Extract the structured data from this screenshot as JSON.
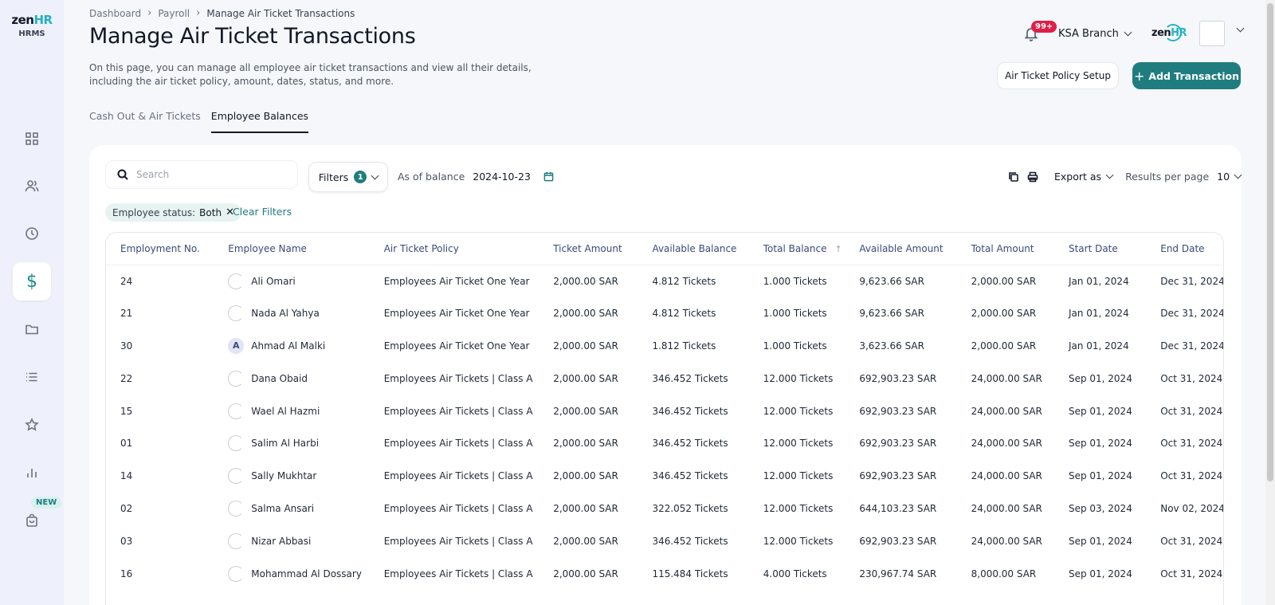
{
  "app": {
    "logo_main": "zen",
    "logo_accent": "HR",
    "logo_sub": "HRMS"
  },
  "sidebar": {
    "new_badge": "NEW",
    "items": [
      {
        "icon": "grid-icon"
      },
      {
        "icon": "users-icon"
      },
      {
        "icon": "clock-icon"
      },
      {
        "icon": "dollar-icon",
        "glyph": "$",
        "active": true
      },
      {
        "icon": "folder-icon"
      },
      {
        "icon": "list-icon"
      },
      {
        "icon": "star-icon"
      },
      {
        "icon": "bar-chart-icon"
      },
      {
        "icon": "bag-icon"
      }
    ]
  },
  "breadcrumb": {
    "items": [
      "Dashboard",
      "Payroll",
      "Manage Air Ticket Transactions"
    ]
  },
  "page": {
    "title": "Manage Air Ticket Transactions",
    "description": "On this page, you can manage all employee air ticket transactions and view all their details, including the air ticket policy, amount, dates, status, and more."
  },
  "topbar": {
    "notif_count": "99+",
    "branch": "KSA Branch",
    "brand_logo_main": "zen",
    "brand_logo_accent": "HR"
  },
  "actions": {
    "policy_setup": "Air Ticket Policy Setup",
    "add_transaction": "Add Transaction"
  },
  "tabs": [
    {
      "label": "Cash Out & Air Tickets"
    },
    {
      "label": "Employee Balances",
      "active": true
    }
  ],
  "toolbar": {
    "search_placeholder": "Search",
    "filters_label": "Filters",
    "filters_count": "1",
    "as_of_label": "As of balance",
    "as_of_date": "2024-10-23",
    "export_label": "Export as",
    "results_label": "Results per page",
    "results_value": "10"
  },
  "active_filter": {
    "label": "Employee status:",
    "value": "Both",
    "clear": "Clear Filters"
  },
  "table": {
    "columns": [
      "Employment No.",
      "Employee Name",
      "Air Ticket Policy",
      "Ticket Amount",
      "Available Balance",
      "Total Balance",
      "Available Amount",
      "Total Amount",
      "Start Date",
      "End Date"
    ],
    "rows": [
      [
        "24",
        "Ali Omari",
        "Employees Air Ticket One Year",
        "2,000.00 SAR",
        "4.812 Tickets",
        "1.000 Tickets",
        "9,623.66 SAR",
        "2,000.00 SAR",
        "Jan 01, 2024",
        "Dec 31, 2024"
      ],
      [
        "21",
        "Nada Al Yahya",
        "Employees Air Ticket One Year",
        "2,000.00 SAR",
        "4.812 Tickets",
        "1.000 Tickets",
        "9,623.66 SAR",
        "2,000.00 SAR",
        "Jan 01, 2024",
        "Dec 31, 2024"
      ],
      [
        "30",
        "Ahmad Al Malki",
        "Employees Air Ticket One Year",
        "2,000.00 SAR",
        "1.812 Tickets",
        "1.000 Tickets",
        "3,623.66 SAR",
        "2,000.00 SAR",
        "Jan 01, 2024",
        "Dec 31, 2024"
      ],
      [
        "22",
        "Dana Obaid",
        "Employees Air Tickets | Class A",
        "2,000.00 SAR",
        "346.452 Tickets",
        "12.000 Tickets",
        "692,903.23 SAR",
        "24,000.00 SAR",
        "Sep 01, 2024",
        "Oct 31, 2024"
      ],
      [
        "15",
        "Wael Al Hazmi",
        "Employees Air Tickets | Class A",
        "2,000.00 SAR",
        "346.452 Tickets",
        "12.000 Tickets",
        "692,903.23 SAR",
        "24,000.00 SAR",
        "Sep 01, 2024",
        "Oct 31, 2024"
      ],
      [
        "01",
        "Salim Al Harbi",
        "Employees Air Tickets | Class A",
        "2,000.00 SAR",
        "346.452 Tickets",
        "12.000 Tickets",
        "692,903.23 SAR",
        "24,000.00 SAR",
        "Sep 01, 2024",
        "Oct 31, 2024"
      ],
      [
        "14",
        "Sally Mukhtar",
        "Employees Air Tickets | Class A",
        "2,000.00 SAR",
        "346.452 Tickets",
        "12.000 Tickets",
        "692,903.23 SAR",
        "24,000.00 SAR",
        "Sep 01, 2024",
        "Oct 31, 2024"
      ],
      [
        "02",
        "Salma Ansari",
        "Employees Air Tickets | Class A",
        "2,000.00 SAR",
        "322.052 Tickets",
        "12.000 Tickets",
        "644,103.23 SAR",
        "24,000.00 SAR",
        "Sep 03, 2024",
        "Nov 02, 2024"
      ],
      [
        "03",
        "Nizar Abbasi",
        "Employees Air Tickets | Class A",
        "2,000.00 SAR",
        "346.452 Tickets",
        "12.000 Tickets",
        "692,903.23 SAR",
        "24,000.00 SAR",
        "Sep 01, 2024",
        "Oct 31, 2024"
      ],
      [
        "16",
        "Mohammad Al Dossary",
        "Employees Air Tickets | Class A",
        "2,000.00 SAR",
        "115.484 Tickets",
        "4.000 Tickets",
        "230,967.74 SAR",
        "8,000.00 SAR",
        "Sep 01, 2024",
        "Oct 31, 2024"
      ]
    ],
    "avatar_letters": {
      "2": "A"
    }
  },
  "colors": {
    "primary": "#1f7d80",
    "accent": "#22b3c4",
    "badge": "#e11d48",
    "header_text": "#3b4a7a",
    "sidebar_bg": "#eef0fb"
  }
}
